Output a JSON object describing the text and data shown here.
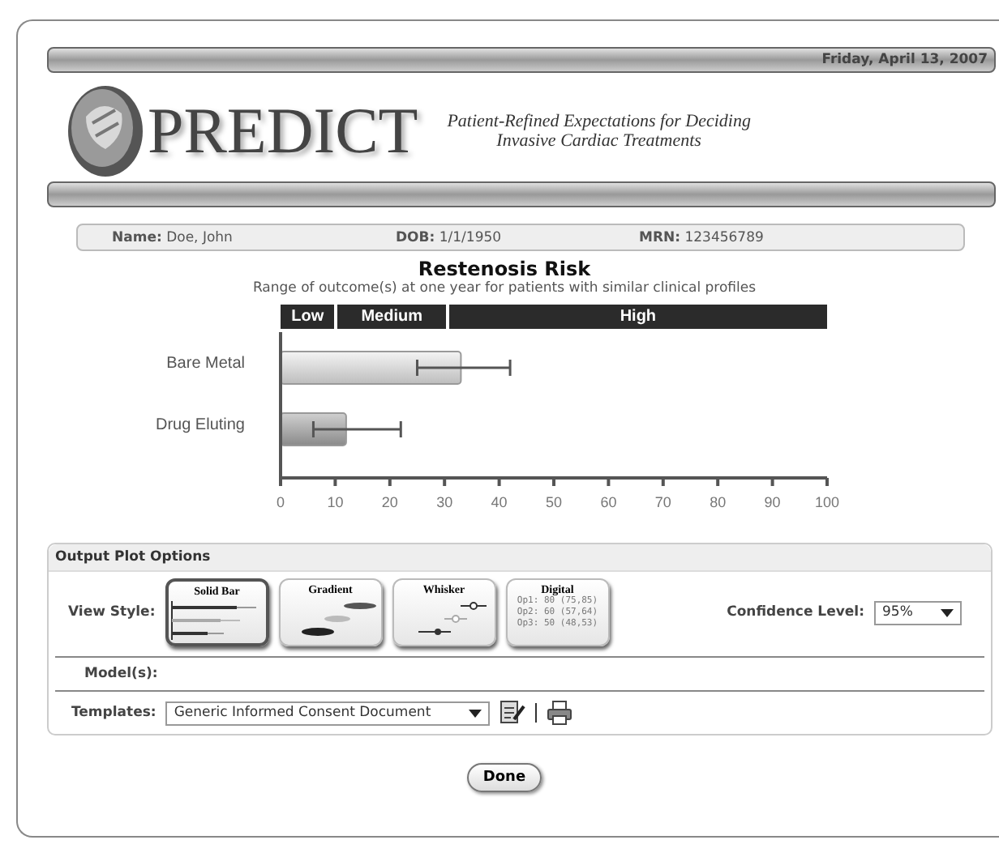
{
  "header": {
    "date": "Friday, April 13, 2007"
  },
  "brand": {
    "name": "PREDICT",
    "tagline_line1": "Patient-Refined Expectations for Deciding",
    "tagline_line2": "Invasive Cardiac Treatments"
  },
  "patient": [
    {
      "label": "Name:",
      "value": "Doe, John"
    },
    {
      "label": "DOB:",
      "value": "1/1/1950"
    },
    {
      "label": "MRN:",
      "value": "123456789"
    }
  ],
  "risk": {
    "title": "Restenosis Risk",
    "subtitle": "Range of outcome(s) at one year for patients with similar clinical profiles",
    "chart_data": {
      "type": "bar",
      "orientation": "horizontal",
      "categories": [
        "Bare Metal",
        "Drug Eluting"
      ],
      "values": [
        33,
        12
      ],
      "xlim": [
        0,
        100
      ],
      "xticks": [
        0,
        10,
        20,
        30,
        40,
        50,
        60,
        70,
        80,
        90,
        100
      ],
      "errors": [
        [
          25,
          42
        ],
        [
          6,
          22
        ]
      ]
    },
    "risk_levels": [
      "Low",
      "Medium",
      "High"
    ]
  },
  "options": {
    "title": "Output Plot Options",
    "view_style_label": "View Style:",
    "styles": [
      {
        "kind": "solid",
        "label": "Solid Bar",
        "selected": true
      },
      {
        "kind": "gradient",
        "label": "Gradient",
        "selected": false
      },
      {
        "kind": "whisker",
        "label": "Whisker",
        "selected": false
      },
      {
        "kind": "digital",
        "label": "Digital",
        "selected": false,
        "lines": [
          "Op1: 80 (75,85)",
          "Op2: 60 (57,64)",
          "Op3: 50 (48,53)"
        ]
      }
    ],
    "confidence_label": "Confidence Level:",
    "confidence_value": "95%",
    "models_label": "Model(s):",
    "templates_label": "Templates:",
    "template_value": "Generic Informed Consent Document"
  },
  "done_button": "Done"
}
